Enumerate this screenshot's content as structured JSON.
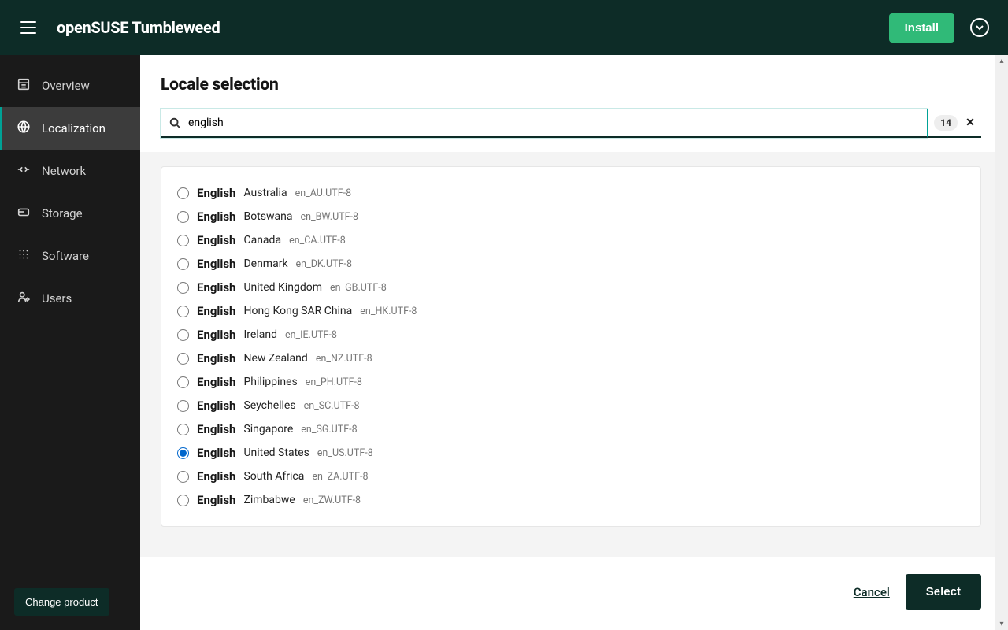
{
  "header": {
    "title": "openSUSE Tumbleweed",
    "install_label": "Install"
  },
  "sidebar": {
    "items": [
      {
        "label": "Overview",
        "icon": "overview"
      },
      {
        "label": "Localization",
        "icon": "globe"
      },
      {
        "label": "Network",
        "icon": "network"
      },
      {
        "label": "Storage",
        "icon": "storage"
      },
      {
        "label": "Software",
        "icon": "software"
      },
      {
        "label": "Users",
        "icon": "users"
      }
    ],
    "active_index": 1,
    "change_product_label": "Change product"
  },
  "page": {
    "title": "Locale selection",
    "search_value": "english",
    "result_count": "14",
    "cancel_label": "Cancel",
    "select_label": "Select"
  },
  "locales": [
    {
      "lang": "English",
      "country": "Australia",
      "code": "en_AU.UTF-8",
      "selected": false
    },
    {
      "lang": "English",
      "country": "Botswana",
      "code": "en_BW.UTF-8",
      "selected": false
    },
    {
      "lang": "English",
      "country": "Canada",
      "code": "en_CA.UTF-8",
      "selected": false
    },
    {
      "lang": "English",
      "country": "Denmark",
      "code": "en_DK.UTF-8",
      "selected": false
    },
    {
      "lang": "English",
      "country": "United Kingdom",
      "code": "en_GB.UTF-8",
      "selected": false
    },
    {
      "lang": "English",
      "country": "Hong Kong SAR China",
      "code": "en_HK.UTF-8",
      "selected": false
    },
    {
      "lang": "English",
      "country": "Ireland",
      "code": "en_IE.UTF-8",
      "selected": false
    },
    {
      "lang": "English",
      "country": "New Zealand",
      "code": "en_NZ.UTF-8",
      "selected": false
    },
    {
      "lang": "English",
      "country": "Philippines",
      "code": "en_PH.UTF-8",
      "selected": false
    },
    {
      "lang": "English",
      "country": "Seychelles",
      "code": "en_SC.UTF-8",
      "selected": false
    },
    {
      "lang": "English",
      "country": "Singapore",
      "code": "en_SG.UTF-8",
      "selected": false
    },
    {
      "lang": "English",
      "country": "United States",
      "code": "en_US.UTF-8",
      "selected": true
    },
    {
      "lang": "English",
      "country": "South Africa",
      "code": "en_ZA.UTF-8",
      "selected": false
    },
    {
      "lang": "English",
      "country": "Zimbabwe",
      "code": "en_ZW.UTF-8",
      "selected": false
    }
  ]
}
